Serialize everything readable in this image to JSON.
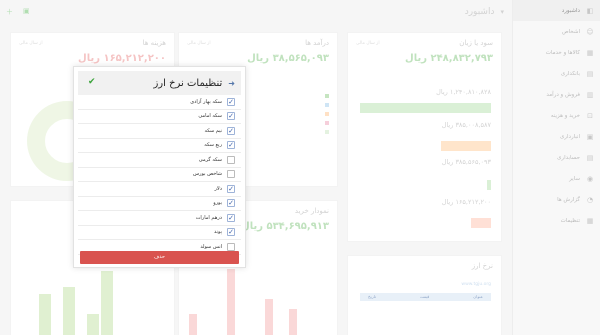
{
  "sidebar": {
    "items": [
      {
        "label": "داشبورد",
        "icon": "dashboard-icon"
      },
      {
        "label": "اشخاص",
        "icon": "people-icon"
      },
      {
        "label": "کالاها و خدمات",
        "icon": "box-icon"
      },
      {
        "label": "بانکداری",
        "icon": "bank-icon"
      },
      {
        "label": "فروش و درآمد",
        "icon": "sales-icon"
      },
      {
        "label": "خرید و هزینه",
        "icon": "cart-icon"
      },
      {
        "label": "انبارداری",
        "icon": "warehouse-icon"
      },
      {
        "label": "حسابداری",
        "icon": "accounting-icon"
      },
      {
        "label": "سایر",
        "icon": "other-icon"
      },
      {
        "label": "گزارش ها",
        "icon": "report-icon"
      },
      {
        "label": "تنظیمات",
        "icon": "settings-icon"
      }
    ]
  },
  "topbar": {
    "title": "داشبورد"
  },
  "cards": {
    "profit": {
      "title": "سود یا زیان",
      "filter": "از سال مالی",
      "value": "۲۴۸,۸۳۲,۷۹۳ ریال",
      "rows": [
        "۱,۲۴۰,۸۱۰,۸۲۸ ریال",
        "۳۸۵,۰۰۸,۵۸۷ ریال",
        "۳۸۵,۵۶۵,۰۹۳ ریال",
        "۱۶۵,۲۱۲,۲۰۰ ریال"
      ]
    },
    "income": {
      "title": "درآمد ها",
      "filter": "از سال مالی",
      "value": "۳۸,۵۶۵,۰۹۳ ریال"
    },
    "expense": {
      "title": "هزینه ها",
      "filter": "از سال مالی",
      "value": "۱۶۵,۲۱۲,۲۰۰ ریال"
    },
    "purchases": {
      "title": "نمودار خرید",
      "value": "۵۳۴,۶۹۵,۹۱۳ ریال"
    },
    "rates": {
      "title": "نرخ ارز",
      "source": "www.tgju.org",
      "headers": [
        "عنوان",
        "قیمت",
        "تاریخ"
      ]
    }
  },
  "modal": {
    "title": "تنظیمات نرخ ارز",
    "items": [
      {
        "label": "سکه بهار آزادی",
        "checked": true
      },
      {
        "label": "سکه امامی",
        "checked": true
      },
      {
        "label": "نیم سکه",
        "checked": true
      },
      {
        "label": "ربع سکه",
        "checked": true
      },
      {
        "label": "سکه گرمی",
        "checked": false
      },
      {
        "label": "شاخص بورس",
        "checked": false
      },
      {
        "label": "دلار",
        "checked": true
      },
      {
        "label": "یورو",
        "checked": true
      },
      {
        "label": "درهم امارات",
        "checked": true
      },
      {
        "label": "پوند",
        "checked": true
      },
      {
        "label": "انس سولد",
        "checked": false
      }
    ],
    "delete_label": "حذف"
  },
  "colors": {
    "accent": "#3a5fa8",
    "danger": "#d9534f",
    "green": "#9fd39b",
    "red": "#f0a5a5"
  }
}
